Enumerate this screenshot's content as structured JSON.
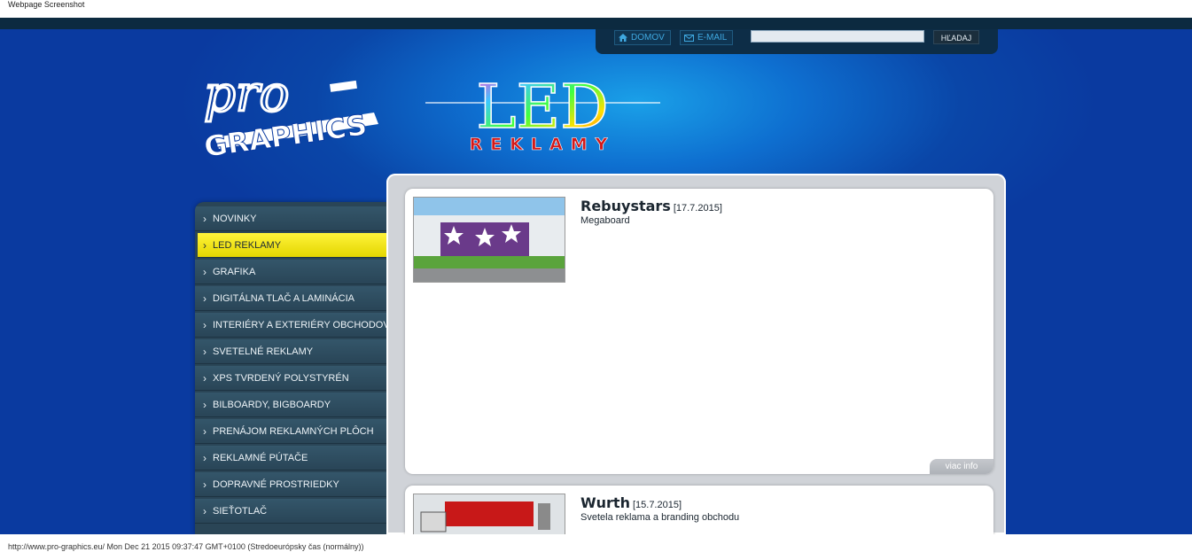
{
  "caption_top": "Webpage Screenshot",
  "caption_bottom": "http://www.pro-graphics.eu/ Mon Dec 21 2015 09:37:47 GMT+0100 (Stredoeurópsky čas (normálny))",
  "toolbar": {
    "home_label": "DOMOV",
    "email_label": "E-MAIL",
    "search_placeholder": "",
    "search_button": "HĽADAJ"
  },
  "logo": {
    "pro_text": "pro",
    "graphics_text": "GRAPHICS",
    "led_text": "LED",
    "reklamy_text": "REKLAMY"
  },
  "menu": [
    {
      "label": "NOVINKY"
    },
    {
      "label": "LED REKLAMY"
    },
    {
      "label": "GRAFIKA"
    },
    {
      "label": "DIGITÁLNA TLAČ A LAMINÁCIA"
    },
    {
      "label": "INTERIÉRY A EXTERIÉRY OBCHODOV"
    },
    {
      "label": "SVETELNÉ REKLAMY"
    },
    {
      "label": "XPS TVRDENÝ POLYSTYRÉN"
    },
    {
      "label": "BILBOARDY, BIGBOARDY"
    },
    {
      "label": "PRENÁJOM REKLAMNÝCH PLÔCH"
    },
    {
      "label": "REKLAMNÉ PÚTAČE"
    },
    {
      "label": "DOPRAVNÉ PROSTRIEDKY"
    },
    {
      "label": "SIEŤOTLAČ"
    }
  ],
  "active_menu": "LED REKLAMY",
  "posts": [
    {
      "title": "Rebuystars",
      "date": "[17.7.2015]",
      "subtitle": "Megaboard",
      "more": "viac info"
    },
    {
      "title": "Wurth",
      "date": "[15.7.2015]",
      "subtitle": "Svetela reklama a branding obchodu"
    }
  ],
  "colors": {
    "accent_yellow": "#f2e60f",
    "site_blue": "#0a46a8",
    "sidebar": "#2a4556"
  }
}
